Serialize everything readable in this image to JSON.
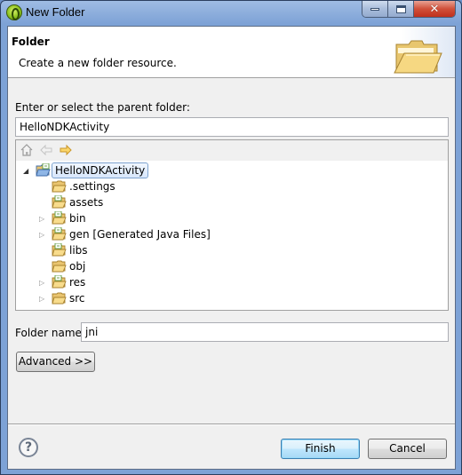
{
  "window": {
    "title": "New Folder",
    "controls": {
      "minimize": "minimize",
      "maximize": "maximize",
      "close": "✕"
    }
  },
  "header": {
    "title": "Folder",
    "description": "Create a new folder resource."
  },
  "parent": {
    "label": "Enter or select the parent folder:",
    "value": "HelloNDKActivity"
  },
  "tree": {
    "toolbar": [
      "home-icon",
      "back-icon",
      "forward-icon"
    ],
    "items": [
      {
        "label": "HelloNDKActivity",
        "level": 0,
        "twisty": "expanded",
        "icon": "project-icon",
        "selected": true
      },
      {
        "label": ".settings",
        "level": 1,
        "twisty": "none",
        "icon": "folder-icon"
      },
      {
        "label": "assets",
        "level": 1,
        "twisty": "none",
        "icon": "source-folder-icon"
      },
      {
        "label": "bin",
        "level": 1,
        "twisty": "collapsed",
        "icon": "source-folder-icon"
      },
      {
        "label": "gen [Generated Java Files]",
        "level": 1,
        "twisty": "collapsed",
        "icon": "source-folder-icon"
      },
      {
        "label": "libs",
        "level": 1,
        "twisty": "none",
        "icon": "source-folder-icon"
      },
      {
        "label": "obj",
        "level": 1,
        "twisty": "none",
        "icon": "folder-icon"
      },
      {
        "label": "res",
        "level": 1,
        "twisty": "collapsed",
        "icon": "source-folder-icon"
      },
      {
        "label": "src",
        "level": 1,
        "twisty": "collapsed",
        "icon": "folder-icon"
      }
    ]
  },
  "folder_name": {
    "label": "Folder name:",
    "value": "jni"
  },
  "buttons": {
    "advanced": "Advanced >>",
    "finish": "Finish",
    "cancel": "Cancel",
    "help": "?"
  }
}
